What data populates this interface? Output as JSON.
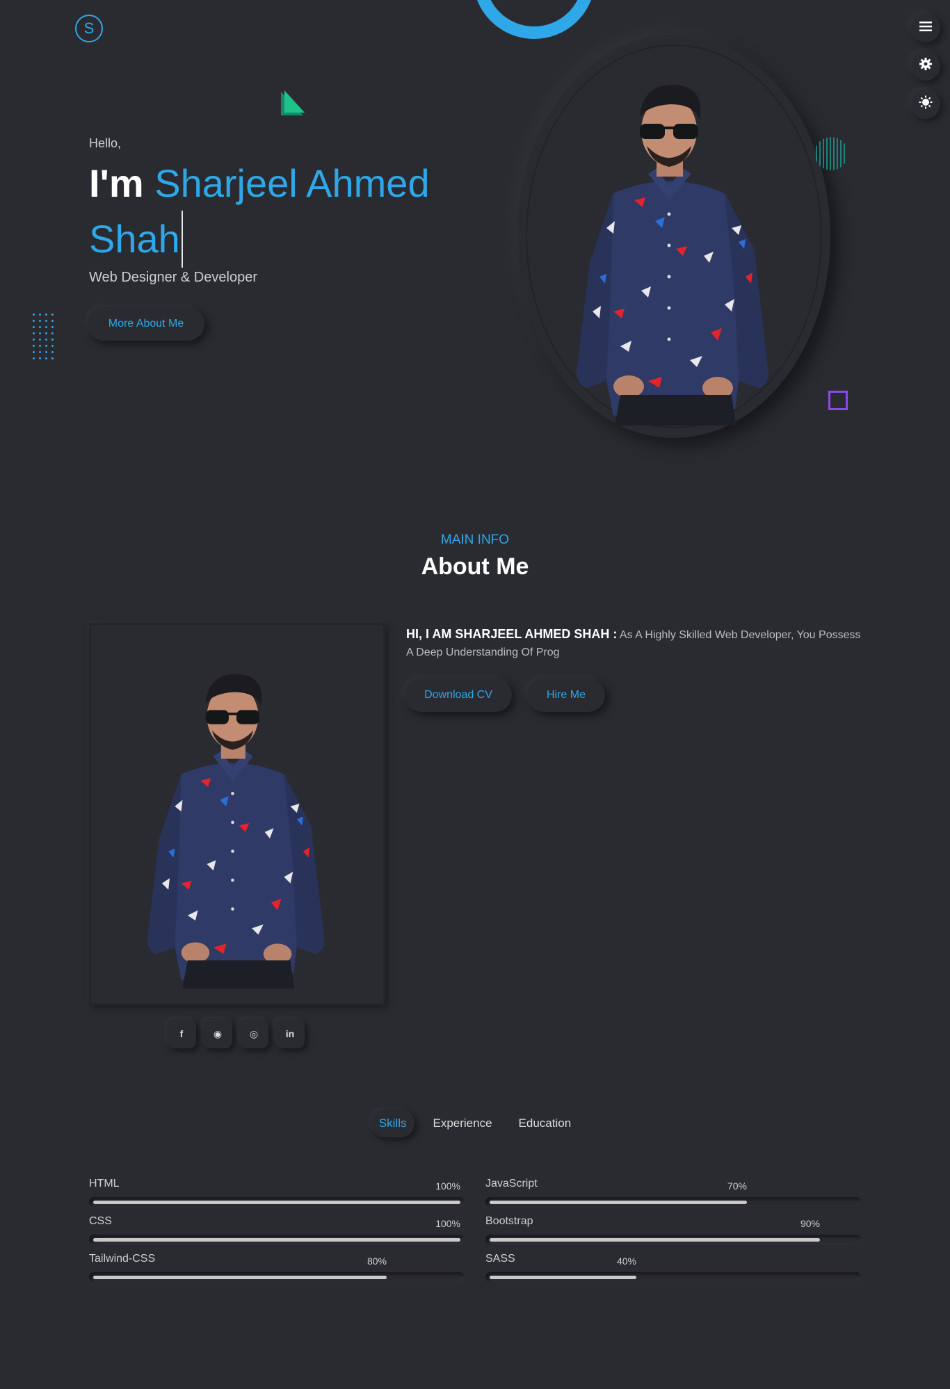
{
  "logo": {
    "letter": "S"
  },
  "side_buttons": [
    {
      "name": "menu",
      "icon": "menu-icon"
    },
    {
      "name": "settings",
      "icon": "gear-icon"
    },
    {
      "name": "theme",
      "icon": "sun-icon"
    }
  ],
  "hero": {
    "greeting": "Hello,",
    "im": "I'm",
    "name": "Sharjeel Ahmed Shah",
    "role": "Web Designer & Developer",
    "more_button": "More About Me"
  },
  "about": {
    "label": "MAIN INFO",
    "title": "About Me",
    "lead": "HI, I AM SHARJEEL AHMED SHAH :",
    "text": "As A Highly Skilled Web Developer, You Possess A Deep Understanding Of Prog",
    "download_button": "Download CV",
    "hire_button": "Hire Me",
    "socials": [
      {
        "name": "facebook",
        "glyph": "f"
      },
      {
        "name": "github",
        "glyph": "◉"
      },
      {
        "name": "instagram",
        "glyph": "◎"
      },
      {
        "name": "linkedin",
        "glyph": "in"
      }
    ]
  },
  "tabs": [
    {
      "label": "Skills",
      "active": true
    },
    {
      "label": "Experience",
      "active": false
    },
    {
      "label": "Education",
      "active": false
    }
  ],
  "skills": [
    {
      "name": "HTML",
      "percent": 100,
      "label": "100%"
    },
    {
      "name": "JavaScript",
      "percent": 70,
      "label": "70%"
    },
    {
      "name": "CSS",
      "percent": 100,
      "label": "100%"
    },
    {
      "name": "Bootstrap",
      "percent": 90,
      "label": "90%"
    },
    {
      "name": "Tailwind-CSS",
      "percent": 80,
      "label": "80%"
    },
    {
      "name": "SASS",
      "percent": 40,
      "label": "40%"
    }
  ],
  "colors": {
    "accent": "#2ea8e8",
    "background": "#2a2b30",
    "square": "#8b4ae8",
    "triangle": "#1ec28b"
  }
}
